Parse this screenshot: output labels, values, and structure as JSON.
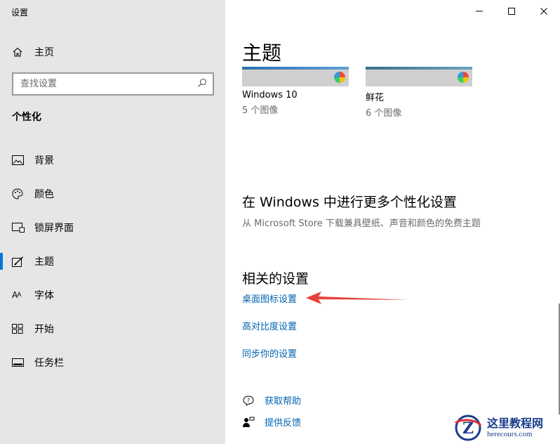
{
  "app": {
    "title": "设置"
  },
  "sidebar": {
    "home_label": "主页",
    "search_placeholder": "查找设置",
    "section_title": "个性化",
    "items": [
      {
        "label": "背景",
        "icon": "image-icon"
      },
      {
        "label": "颜色",
        "icon": "palette-icon"
      },
      {
        "label": "锁屏界面",
        "icon": "lock-screen-icon"
      },
      {
        "label": "主题",
        "icon": "theme-brush-icon",
        "active": true
      },
      {
        "label": "字体",
        "icon": "font-icon"
      },
      {
        "label": "开始",
        "icon": "start-icon"
      },
      {
        "label": "任务栏",
        "icon": "taskbar-icon"
      }
    ]
  },
  "main": {
    "title": "主题",
    "themes": [
      {
        "name": "Windows 10",
        "count": "5 个图像"
      },
      {
        "name": "鲜花",
        "count": "6 个图像"
      }
    ],
    "more_title": "在 Windows 中进行更多个性化设置",
    "more_desc": "从 Microsoft Store 下载兼具壁纸、声音和颜色的免费主题",
    "related_title": "相关的设置",
    "related_links": [
      "桌面图标设置",
      "高对比度设置",
      "同步你的设置"
    ],
    "help_links": [
      {
        "label": "获取帮助",
        "icon": "help-chat-icon"
      },
      {
        "label": "提供反馈",
        "icon": "feedback-icon"
      }
    ]
  },
  "watermark": {
    "main": "这里教程网",
    "sub": "herecours.com"
  },
  "colors": {
    "accent": "#0078d7",
    "link": "#0063b1",
    "sidebar_bg": "#e6e6e6",
    "arrow": "#e8413c"
  }
}
